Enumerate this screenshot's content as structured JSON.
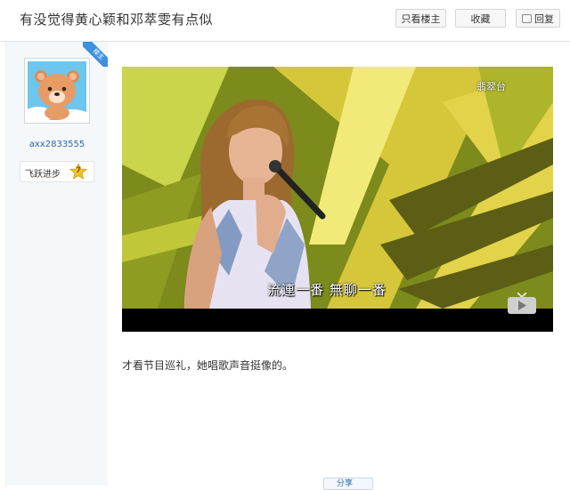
{
  "header": {
    "title": "有没觉得黄心颖和邓萃雯有点似",
    "only_op_label": "只看楼主",
    "favorite_label": "收藏",
    "reply_label": "回复"
  },
  "author": {
    "badge": "楼主",
    "username": "axx2833555",
    "rank_title": "飞跃进步",
    "rank_level": "7"
  },
  "video": {
    "channel_label": "翡翠台",
    "subtitle": "流連一番 無聊一番"
  },
  "post": {
    "text": "才看节目巡礼，她唱歌声音挺像的。"
  },
  "footer": {
    "share_label": "分享"
  }
}
